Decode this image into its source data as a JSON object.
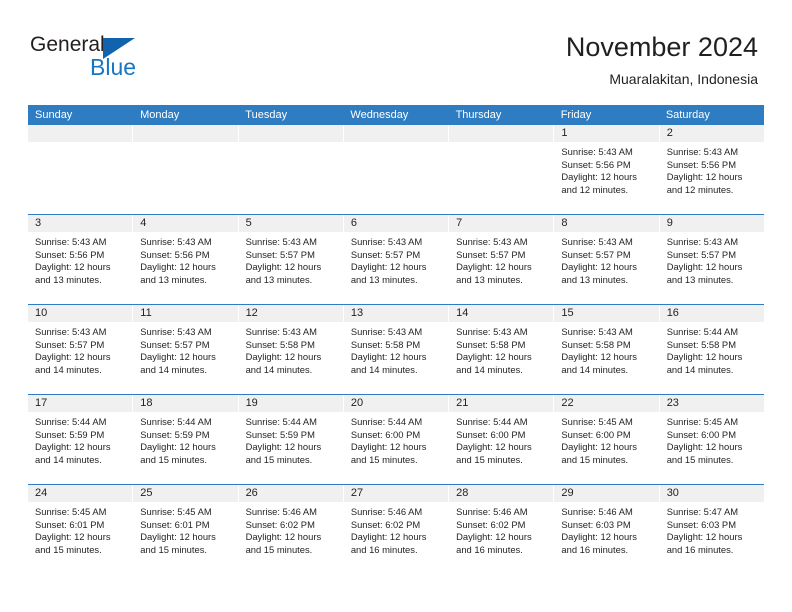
{
  "brand": {
    "name_part1": "General",
    "name_part2": "Blue",
    "triangle_color": "#1263ae",
    "blue_color": "#1777c4"
  },
  "header": {
    "month_title": "November 2024",
    "location": "Muaralakitan, Indonesia"
  },
  "theme": {
    "header_bar_color": "#2e7cc2",
    "date_strip_color": "#f0f0f0",
    "text_color": "#231f20"
  },
  "calendar": {
    "weekdays": [
      "Sunday",
      "Monday",
      "Tuesday",
      "Wednesday",
      "Thursday",
      "Friday",
      "Saturday"
    ],
    "weeks": [
      [
        {
          "day": "",
          "lines": []
        },
        {
          "day": "",
          "lines": []
        },
        {
          "day": "",
          "lines": []
        },
        {
          "day": "",
          "lines": []
        },
        {
          "day": "",
          "lines": []
        },
        {
          "day": "1",
          "lines": [
            "Sunrise: 5:43 AM",
            "Sunset: 5:56 PM",
            "Daylight: 12 hours",
            "and 12 minutes."
          ]
        },
        {
          "day": "2",
          "lines": [
            "Sunrise: 5:43 AM",
            "Sunset: 5:56 PM",
            "Daylight: 12 hours",
            "and 12 minutes."
          ]
        }
      ],
      [
        {
          "day": "3",
          "lines": [
            "Sunrise: 5:43 AM",
            "Sunset: 5:56 PM",
            "Daylight: 12 hours",
            "and 13 minutes."
          ]
        },
        {
          "day": "4",
          "lines": [
            "Sunrise: 5:43 AM",
            "Sunset: 5:56 PM",
            "Daylight: 12 hours",
            "and 13 minutes."
          ]
        },
        {
          "day": "5",
          "lines": [
            "Sunrise: 5:43 AM",
            "Sunset: 5:57 PM",
            "Daylight: 12 hours",
            "and 13 minutes."
          ]
        },
        {
          "day": "6",
          "lines": [
            "Sunrise: 5:43 AM",
            "Sunset: 5:57 PM",
            "Daylight: 12 hours",
            "and 13 minutes."
          ]
        },
        {
          "day": "7",
          "lines": [
            "Sunrise: 5:43 AM",
            "Sunset: 5:57 PM",
            "Daylight: 12 hours",
            "and 13 minutes."
          ]
        },
        {
          "day": "8",
          "lines": [
            "Sunrise: 5:43 AM",
            "Sunset: 5:57 PM",
            "Daylight: 12 hours",
            "and 13 minutes."
          ]
        },
        {
          "day": "9",
          "lines": [
            "Sunrise: 5:43 AM",
            "Sunset: 5:57 PM",
            "Daylight: 12 hours",
            "and 13 minutes."
          ]
        }
      ],
      [
        {
          "day": "10",
          "lines": [
            "Sunrise: 5:43 AM",
            "Sunset: 5:57 PM",
            "Daylight: 12 hours",
            "and 14 minutes."
          ]
        },
        {
          "day": "11",
          "lines": [
            "Sunrise: 5:43 AM",
            "Sunset: 5:57 PM",
            "Daylight: 12 hours",
            "and 14 minutes."
          ]
        },
        {
          "day": "12",
          "lines": [
            "Sunrise: 5:43 AM",
            "Sunset: 5:58 PM",
            "Daylight: 12 hours",
            "and 14 minutes."
          ]
        },
        {
          "day": "13",
          "lines": [
            "Sunrise: 5:43 AM",
            "Sunset: 5:58 PM",
            "Daylight: 12 hours",
            "and 14 minutes."
          ]
        },
        {
          "day": "14",
          "lines": [
            "Sunrise: 5:43 AM",
            "Sunset: 5:58 PM",
            "Daylight: 12 hours",
            "and 14 minutes."
          ]
        },
        {
          "day": "15",
          "lines": [
            "Sunrise: 5:43 AM",
            "Sunset: 5:58 PM",
            "Daylight: 12 hours",
            "and 14 minutes."
          ]
        },
        {
          "day": "16",
          "lines": [
            "Sunrise: 5:44 AM",
            "Sunset: 5:58 PM",
            "Daylight: 12 hours",
            "and 14 minutes."
          ]
        }
      ],
      [
        {
          "day": "17",
          "lines": [
            "Sunrise: 5:44 AM",
            "Sunset: 5:59 PM",
            "Daylight: 12 hours",
            "and 14 minutes."
          ]
        },
        {
          "day": "18",
          "lines": [
            "Sunrise: 5:44 AM",
            "Sunset: 5:59 PM",
            "Daylight: 12 hours",
            "and 15 minutes."
          ]
        },
        {
          "day": "19",
          "lines": [
            "Sunrise: 5:44 AM",
            "Sunset: 5:59 PM",
            "Daylight: 12 hours",
            "and 15 minutes."
          ]
        },
        {
          "day": "20",
          "lines": [
            "Sunrise: 5:44 AM",
            "Sunset: 6:00 PM",
            "Daylight: 12 hours",
            "and 15 minutes."
          ]
        },
        {
          "day": "21",
          "lines": [
            "Sunrise: 5:44 AM",
            "Sunset: 6:00 PM",
            "Daylight: 12 hours",
            "and 15 minutes."
          ]
        },
        {
          "day": "22",
          "lines": [
            "Sunrise: 5:45 AM",
            "Sunset: 6:00 PM",
            "Daylight: 12 hours",
            "and 15 minutes."
          ]
        },
        {
          "day": "23",
          "lines": [
            "Sunrise: 5:45 AM",
            "Sunset: 6:00 PM",
            "Daylight: 12 hours",
            "and 15 minutes."
          ]
        }
      ],
      [
        {
          "day": "24",
          "lines": [
            "Sunrise: 5:45 AM",
            "Sunset: 6:01 PM",
            "Daylight: 12 hours",
            "and 15 minutes."
          ]
        },
        {
          "day": "25",
          "lines": [
            "Sunrise: 5:45 AM",
            "Sunset: 6:01 PM",
            "Daylight: 12 hours",
            "and 15 minutes."
          ]
        },
        {
          "day": "26",
          "lines": [
            "Sunrise: 5:46 AM",
            "Sunset: 6:02 PM",
            "Daylight: 12 hours",
            "and 15 minutes."
          ]
        },
        {
          "day": "27",
          "lines": [
            "Sunrise: 5:46 AM",
            "Sunset: 6:02 PM",
            "Daylight: 12 hours",
            "and 16 minutes."
          ]
        },
        {
          "day": "28",
          "lines": [
            "Sunrise: 5:46 AM",
            "Sunset: 6:02 PM",
            "Daylight: 12 hours",
            "and 16 minutes."
          ]
        },
        {
          "day": "29",
          "lines": [
            "Sunrise: 5:46 AM",
            "Sunset: 6:03 PM",
            "Daylight: 12 hours",
            "and 16 minutes."
          ]
        },
        {
          "day": "30",
          "lines": [
            "Sunrise: 5:47 AM",
            "Sunset: 6:03 PM",
            "Daylight: 12 hours",
            "and 16 minutes."
          ]
        }
      ]
    ]
  }
}
